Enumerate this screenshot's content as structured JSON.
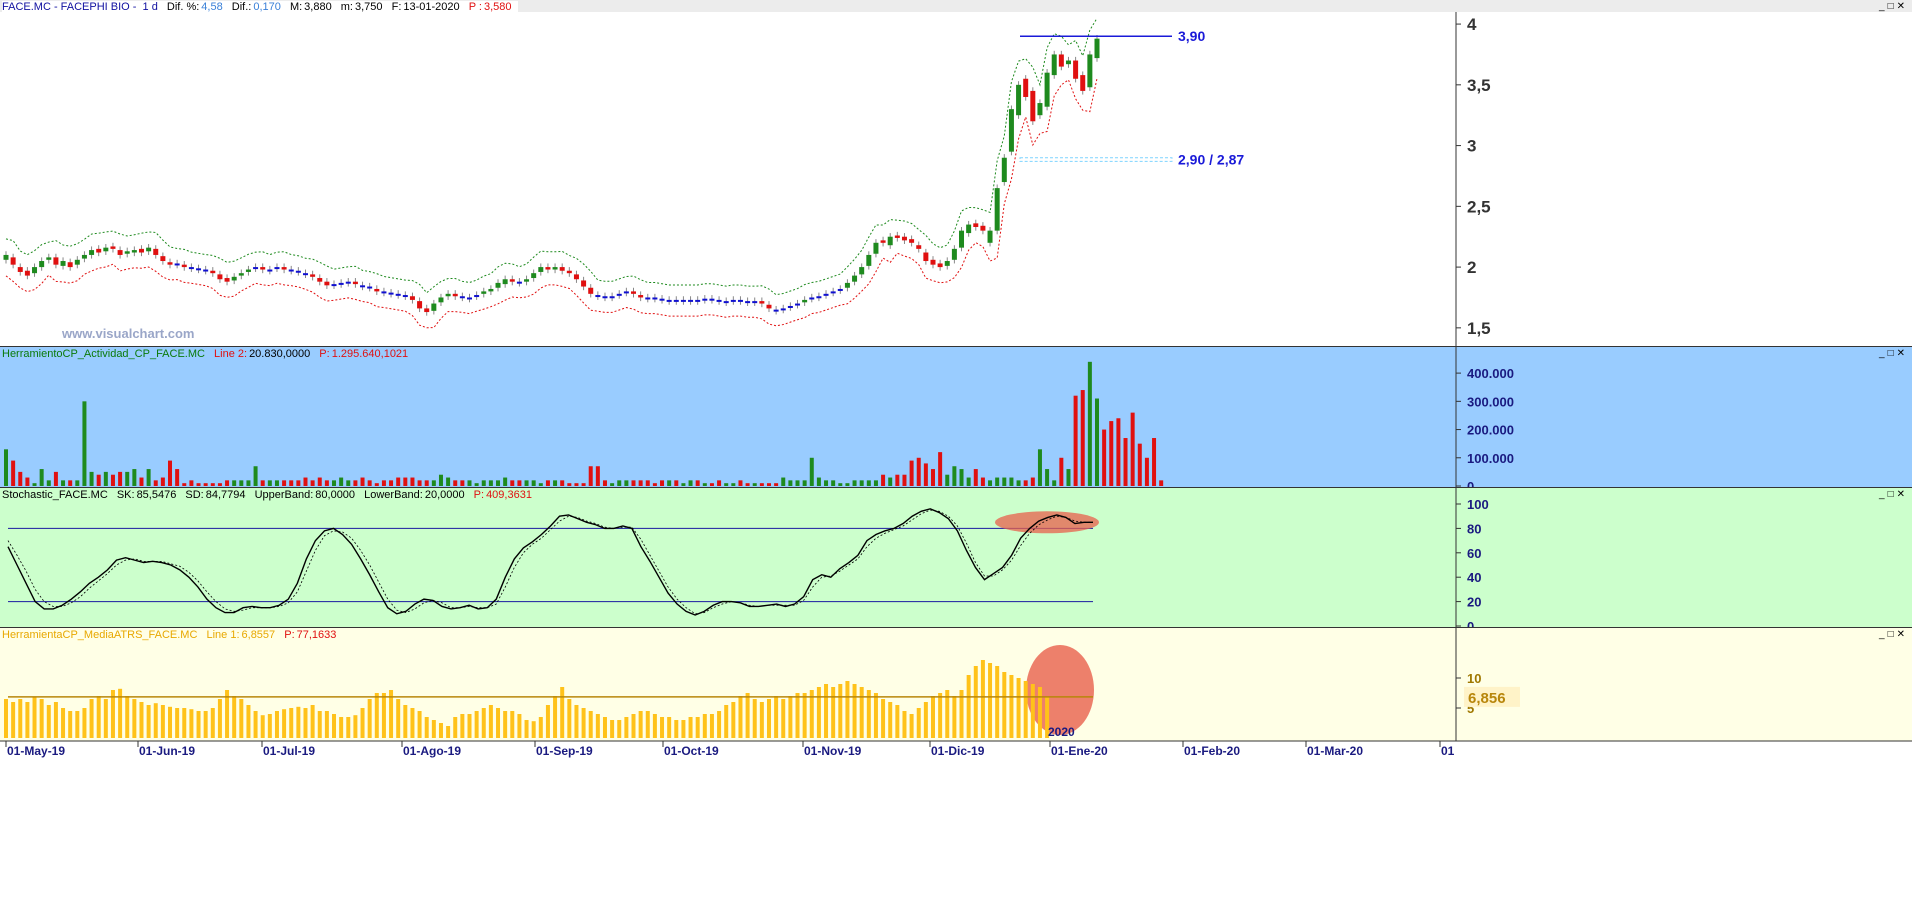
{
  "price_panel": {
    "header": {
      "symbol": "FACE.MC - FACEPHI BIO - ",
      "timeframe": "1 d",
      "dif_pct_label": "Dif. %:",
      "dif_pct": "4,58",
      "dif_label": "Dif.:",
      "dif": "0,170",
      "max_label": "M:",
      "max": "3,880",
      "min_label": "m:",
      "min": "3,750",
      "date_label": "F:",
      "date": "13-01-2020",
      "price_label": "P :",
      "price": "3,580"
    },
    "watermark": "www.visualchart.com",
    "annotations": {
      "resistance": "3,90",
      "support": "2,90 / 2,87"
    },
    "colors": {
      "up": "#1e8a1e",
      "down": "#e01010",
      "neutral": "#1010d0",
      "upper_band": "#1e8a1e",
      "lower_band": "#e01010"
    }
  },
  "volume_panel": {
    "header": {
      "name": "HerramientoCP_Actividad_CP_FACE.MC",
      "line_label": "Line 2:",
      "line_value": "20.830,0000",
      "p_label": "P:",
      "p_value": "1.295.640,1021"
    }
  },
  "stoch_panel": {
    "header": {
      "name": "Stochastic_FACE.MC",
      "sk_label": "SK:",
      "sk": "85,5476",
      "sd_label": "SD:",
      "sd": "84,7794",
      "ub_label": "UpperBand:",
      "ub": "80,0000",
      "lb_label": "LowerBand:",
      "lb": "20,0000",
      "p_label": "P:",
      "p": "409,3631"
    }
  },
  "atr_panel": {
    "header": {
      "name": "HerramientaCP_MediaATRS_FACE.MC",
      "line_label": "Line 1:",
      "line_value": "6,8557",
      "p_label": "P:",
      "p_value": "77,1633"
    },
    "value_badge": "6,856",
    "year_marker": "2020"
  },
  "x_axis": {
    "labels": [
      "01-May-19",
      "01-Jun-19",
      "01-Jul-19",
      "01-Ago-19",
      "01-Sep-19",
      "01-Oct-19",
      "01-Nov-19",
      "01-Dic-19",
      "01-Ene-20",
      "01-Feb-20",
      "01-Mar-20",
      "01"
    ]
  },
  "chart_data": [
    {
      "type": "candlestick",
      "title": "FACE.MC - FACEPHI BIO - 1 d",
      "ylim": [
        1.4,
        4.05
      ],
      "y_ticks": [
        "4",
        "3,5",
        "3",
        "2,5",
        "2",
        "1,5"
      ],
      "close": [
        2.1,
        2.02,
        1.96,
        1.93,
        2.0,
        2.05,
        2.08,
        2.02,
        2.05,
        2.0,
        2.06,
        2.1,
        2.14,
        2.12,
        2.16,
        2.15,
        2.1,
        2.13,
        2.14,
        2.12,
        2.16,
        2.1,
        2.05,
        2.02,
        2.02,
        2.0,
        1.99,
        1.98,
        1.97,
        1.95,
        1.9,
        1.88,
        1.92,
        1.95,
        1.98,
        2.0,
        1.98,
        1.98,
        2.0,
        1.98,
        1.97,
        1.96,
        1.94,
        1.92,
        1.88,
        1.85,
        1.86,
        1.87,
        1.88,
        1.86,
        1.84,
        1.83,
        1.8,
        1.79,
        1.78,
        1.77,
        1.76,
        1.73,
        1.66,
        1.63,
        1.7,
        1.75,
        1.78,
        1.76,
        1.75,
        1.75,
        1.77,
        1.8,
        1.82,
        1.87,
        1.9,
        1.88,
        1.87,
        1.9,
        1.95,
        2.0,
        1.98,
        2.0,
        1.97,
        1.95,
        1.9,
        1.84,
        1.78,
        1.76,
        1.75,
        1.76,
        1.78,
        1.8,
        1.78,
        1.75,
        1.74,
        1.74,
        1.73,
        1.73,
        1.72,
        1.73,
        1.73,
        1.72,
        1.74,
        1.73,
        1.72,
        1.72,
        1.73,
        1.72,
        1.71,
        1.72,
        1.7,
        1.66,
        1.64,
        1.66,
        1.68,
        1.7,
        1.73,
        1.75,
        1.76,
        1.78,
        1.8,
        1.82,
        1.87,
        1.93,
        2.0,
        2.1,
        2.2,
        2.2,
        2.25,
        2.24,
        2.22,
        2.2,
        2.15,
        2.05,
        2.02,
        2.0,
        2.05,
        2.15,
        2.3,
        2.35,
        2.33,
        2.3,
        2.3,
        2.65,
        2.9,
        3.3,
        3.5,
        3.4,
        3.2,
        3.35,
        3.6,
        3.75,
        3.65,
        3.7,
        3.55,
        3.45,
        3.75,
        3.88
      ],
      "open": [
        2.06,
        2.08,
        2.0,
        1.97,
        1.95,
        2.0,
        2.06,
        2.08,
        2.01,
        2.04,
        2.02,
        2.07,
        2.1,
        2.15,
        2.13,
        2.17,
        2.14,
        2.11,
        2.12,
        2.15,
        2.13,
        2.15,
        2.09,
        2.04,
        2.03,
        2.02,
        2.0,
        1.99,
        1.98,
        1.97,
        1.94,
        1.91,
        1.89,
        1.93,
        1.96,
        1.99,
        2.0,
        1.97,
        1.99,
        2.0,
        1.98,
        1.97,
        1.95,
        1.94,
        1.91,
        1.88,
        1.85,
        1.86,
        1.87,
        1.88,
        1.85,
        1.84,
        1.82,
        1.8,
        1.79,
        1.78,
        1.77,
        1.76,
        1.72,
        1.66,
        1.64,
        1.71,
        1.76,
        1.78,
        1.76,
        1.74,
        1.76,
        1.78,
        1.8,
        1.83,
        1.86,
        1.9,
        1.88,
        1.88,
        1.91,
        1.96,
        2.0,
        1.98,
        2.0,
        1.97,
        1.94,
        1.89,
        1.83,
        1.77,
        1.76,
        1.75,
        1.77,
        1.79,
        1.8,
        1.77,
        1.75,
        1.75,
        1.74,
        1.72,
        1.73,
        1.72,
        1.72,
        1.73,
        1.73,
        1.74,
        1.73,
        1.71,
        1.72,
        1.73,
        1.72,
        1.71,
        1.72,
        1.69,
        1.65,
        1.65,
        1.67,
        1.69,
        1.71,
        1.74,
        1.75,
        1.77,
        1.79,
        1.81,
        1.83,
        1.88,
        1.94,
        2.01,
        2.11,
        2.22,
        2.18,
        2.26,
        2.25,
        2.23,
        2.18,
        2.12,
        2.06,
        2.03,
        2.01,
        2.06,
        2.16,
        2.28,
        2.36,
        2.34,
        2.2,
        2.3,
        2.7,
        2.95,
        3.25,
        3.55,
        3.45,
        3.25,
        3.32,
        3.58,
        3.75,
        3.67,
        3.7,
        3.58,
        3.48,
        3.72
      ]
    },
    {
      "type": "bar",
      "title": "HerramientoCP_Actividad_CP_FACE.MC",
      "ylim": [
        0,
        450000
      ],
      "y_ticks": [
        "400.000",
        "300.000",
        "200.000",
        "100.000",
        "0"
      ],
      "values": [
        130000,
        90000,
        50000,
        30000,
        10000,
        60000,
        20000,
        50000,
        20000,
        20000,
        20000,
        300000,
        50000,
        40000,
        50000,
        40000,
        50000,
        50000,
        60000,
        30000,
        60000,
        20000,
        30000,
        90000,
        60000,
        10000,
        20000,
        10000,
        10000,
        10000,
        10000,
        20000,
        20000,
        20000,
        20000,
        70000,
        20000,
        20000,
        20000,
        20000,
        20000,
        20000,
        30000,
        20000,
        30000,
        20000,
        20000,
        30000,
        20000,
        20000,
        30000,
        20000,
        10000,
        20000,
        20000,
        30000,
        30000,
        30000,
        20000,
        20000,
        20000,
        40000,
        30000,
        20000,
        20000,
        20000,
        10000,
        20000,
        20000,
        20000,
        30000,
        20000,
        20000,
        20000,
        20000,
        10000,
        20000,
        20000,
        20000,
        10000,
        10000,
        10000,
        70000,
        70000,
        20000,
        10000,
        20000,
        20000,
        20000,
        20000,
        20000,
        10000,
        20000,
        20000,
        20000,
        10000,
        20000,
        20000,
        10000,
        10000,
        20000,
        10000,
        10000,
        20000,
        10000,
        10000,
        10000,
        10000,
        10000,
        30000,
        20000,
        20000,
        20000,
        100000,
        30000,
        20000,
        20000,
        10000,
        10000,
        20000,
        20000,
        20000,
        20000,
        40000,
        30000,
        40000,
        40000,
        90000,
        100000,
        80000,
        60000,
        120000,
        40000,
        70000,
        60000,
        30000,
        60000,
        30000,
        20000,
        30000,
        30000,
        30000,
        20000,
        20000,
        30000,
        130000,
        60000,
        20000,
        100000,
        60000,
        320000,
        340000,
        440000,
        310000,
        200000,
        230000,
        240000,
        170000,
        260000,
        150000,
        100000,
        170000,
        20000
      ]
    },
    {
      "type": "line",
      "title": "Stochastic_FACE.MC",
      "ylim": [
        0,
        100
      ],
      "y_ticks": [
        "100",
        "80",
        "60",
        "40",
        "20",
        "0"
      ],
      "bands": [
        80,
        20
      ],
      "series": [
        {
          "name": "SK",
          "values": [
            65,
            50,
            35,
            20,
            14,
            14,
            17,
            22,
            28,
            35,
            40,
            46,
            54,
            56,
            54,
            52,
            53,
            52,
            50,
            46,
            40,
            32,
            22,
            15,
            11,
            11,
            15,
            16,
            15,
            15,
            17,
            22,
            35,
            55,
            70,
            78,
            80,
            75,
            67,
            55,
            42,
            28,
            15,
            10,
            12,
            18,
            22,
            21,
            16,
            14,
            15,
            17,
            14,
            15,
            22,
            40,
            55,
            64,
            69,
            75,
            82,
            90,
            91,
            88,
            85,
            83,
            80,
            80,
            82,
            80,
            65,
            53,
            40,
            27,
            18,
            12,
            9,
            12,
            17,
            20,
            20,
            19,
            16,
            16,
            17,
            18,
            16,
            18,
            24,
            38,
            42,
            40,
            47,
            52,
            58,
            70,
            75,
            78,
            80,
            84,
            90,
            94,
            96,
            93,
            88,
            78,
            62,
            48,
            38,
            43,
            48,
            58,
            72,
            80,
            86,
            89,
            91,
            89,
            84,
            85,
            85
          ]
        },
        {
          "name": "SD",
          "values": [
            70,
            58,
            45,
            30,
            20,
            16,
            16,
            19,
            24,
            31,
            37,
            43,
            50,
            54,
            55,
            53,
            53,
            53,
            51,
            49,
            44,
            37,
            28,
            20,
            14,
            12,
            13,
            15,
            15,
            15,
            16,
            19,
            28,
            45,
            62,
            74,
            78,
            77,
            72,
            62,
            50,
            36,
            22,
            13,
            11,
            14,
            19,
            21,
            19,
            15,
            15,
            16,
            15,
            15,
            18,
            32,
            48,
            60,
            67,
            72,
            79,
            86,
            90,
            89,
            86,
            84,
            81,
            80,
            81,
            81,
            71,
            58,
            45,
            32,
            22,
            15,
            10,
            11,
            15,
            18,
            20,
            19,
            17,
            16,
            17,
            17,
            17,
            17,
            21,
            32,
            40,
            41,
            45,
            50,
            55,
            65,
            72,
            76,
            79,
            82,
            87,
            92,
            95,
            94,
            90,
            82,
            68,
            52,
            41,
            41,
            46,
            54,
            66,
            76,
            83,
            87,
            90,
            89,
            86,
            85,
            85
          ]
        }
      ]
    },
    {
      "type": "bar",
      "title": "HerramientaCP_MediaATRS_FACE.MC",
      "ylim": [
        0,
        15
      ],
      "y_ticks": [
        "10",
        "5"
      ],
      "values": [
        6.5,
        6.0,
        6.5,
        6.0,
        6.8,
        6.5,
        5.5,
        6.0,
        5.0,
        4.5,
        4.5,
        5.0,
        6.5,
        7.0,
        6.5,
        8.0,
        8.2,
        7.0,
        6.5,
        6.0,
        5.5,
        5.8,
        5.5,
        5.2,
        5.0,
        5.0,
        4.8,
        4.5,
        4.5,
        5.0,
        6.5,
        8.0,
        7.0,
        6.5,
        5.5,
        4.5,
        3.8,
        4.0,
        4.5,
        4.8,
        5.0,
        5.2,
        5.0,
        5.5,
        4.5,
        4.5,
        4.0,
        3.5,
        3.5,
        3.8,
        5.0,
        6.5,
        7.5,
        7.5,
        8.0,
        6.5,
        5.5,
        5.0,
        4.5,
        3.5,
        3.0,
        2.5,
        2.0,
        3.5,
        4.0,
        4.0,
        4.5,
        5.0,
        5.5,
        5.0,
        4.5,
        4.5,
        4.0,
        3.0,
        2.8,
        3.5,
        5.5,
        7.0,
        8.5,
        6.5,
        5.5,
        5.0,
        4.5,
        4.0,
        3.5,
        3.0,
        3.0,
        3.5,
        4.0,
        4.5,
        4.5,
        4.0,
        3.5,
        3.5,
        3.0,
        3.0,
        3.5,
        3.5,
        4.0,
        4.0,
        4.5,
        5.5,
        6.0,
        7.0,
        7.5,
        6.5,
        6.0,
        6.5,
        7.0,
        6.5,
        7.0,
        7.5,
        7.5,
        8.0,
        8.5,
        9.0,
        8.5,
        9.0,
        9.5,
        9.0,
        8.5,
        8.0,
        7.5,
        6.5,
        6.0,
        5.5,
        4.5,
        4.0,
        5.0,
        6.0,
        7.0,
        7.5,
        8.0,
        7.0,
        8.0,
        10.5,
        12.0,
        13.0,
        12.5,
        12.0,
        11.0,
        10.5,
        10.0,
        9.5,
        9.0,
        8.5,
        6.8
      ],
      "average_line": 6.856
    }
  ]
}
